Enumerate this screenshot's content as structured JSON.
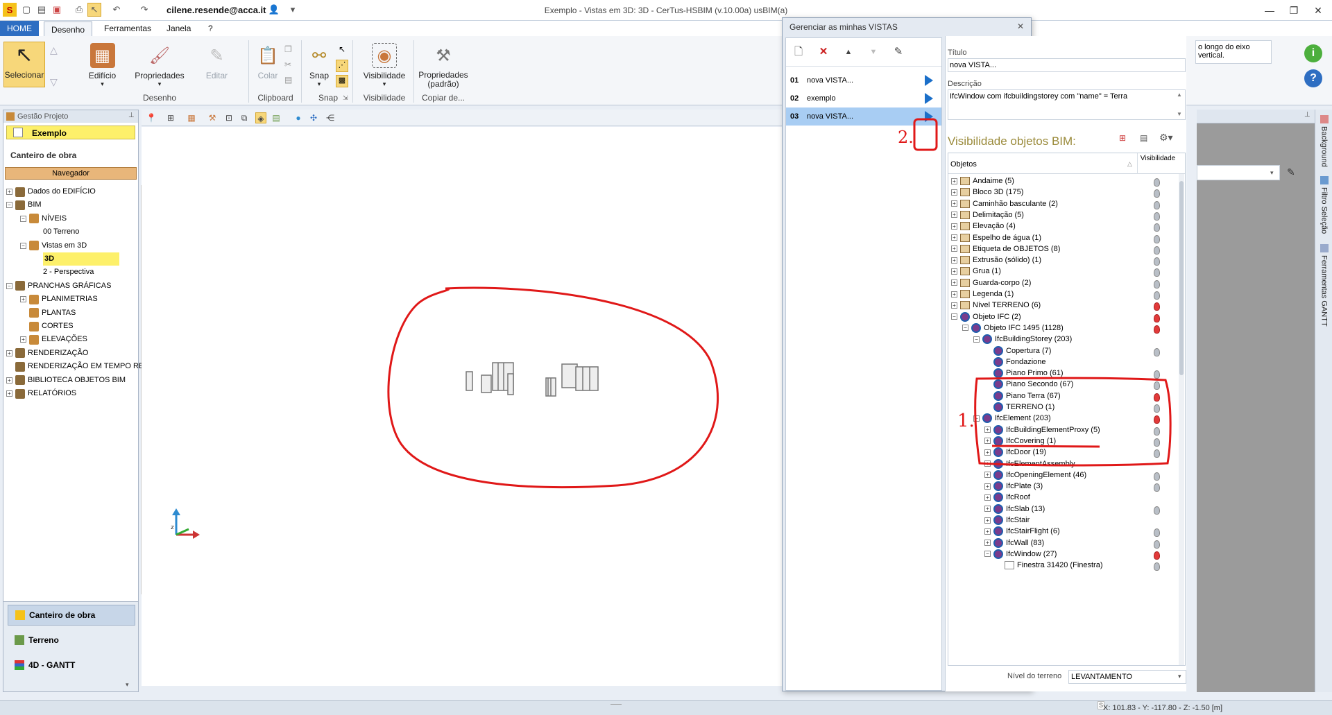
{
  "titlebar": {
    "user": "cilene.resende@acca.it",
    "window_title": "Exemplo - Vistas em 3D: 3D - CerTus-HSBIM (v.10.00a) usBIM(a)",
    "minimize": "—",
    "maximize": "❐",
    "close": "✕"
  },
  "menu": {
    "home": "HOME",
    "desenho": "Desenho",
    "ferramentas": "Ferramentas",
    "janela": "Janela",
    "help": "?"
  },
  "ribbon": {
    "selecionar": "Selecionar",
    "edificio": "Edifício",
    "propriedades": "Propriedades",
    "editar": "Editar",
    "colar": "Colar",
    "snap": "Snap",
    "visibilidade": "Visibilidade",
    "propriedades_padrao": "Propriedades (padrão)",
    "group_desenho": "Desenho",
    "group_clipboard": "Clipboard",
    "group_snap": "Snap",
    "group_visibilidade": "Visibilidade",
    "group_copiar": "Copiar de..."
  },
  "left_panel": {
    "header": "Gestão Projeto",
    "project": "Exemplo",
    "section": "Canteiro de obra",
    "navigator": "Navegador",
    "tree": [
      {
        "label": "Dados do EDIFÍCIO",
        "level": 0,
        "expander": "+"
      },
      {
        "label": "BIM",
        "level": 0,
        "expander": "−"
      },
      {
        "label": "NÍVEIS",
        "level": 1,
        "expander": "−"
      },
      {
        "label": "00 Terreno",
        "level": 2,
        "expander": ""
      },
      {
        "label": "Vistas em 3D",
        "level": 1,
        "expander": "−"
      },
      {
        "label": "3D",
        "level": 2,
        "expander": "",
        "highlight": true
      },
      {
        "label": "2 - Perspectiva",
        "level": 2,
        "expander": ""
      },
      {
        "label": "PRANCHAS GRÁFICAS",
        "level": 0,
        "expander": "−"
      },
      {
        "label": "PLANIMETRIAS",
        "level": 1,
        "expander": "+"
      },
      {
        "label": "PLANTAS",
        "level": 1,
        "expander": ""
      },
      {
        "label": "CORTES",
        "level": 1,
        "expander": ""
      },
      {
        "label": "ELEVAÇÕES",
        "level": 1,
        "expander": "+"
      },
      {
        "label": "RENDERIZAÇÃO",
        "level": 0,
        "expander": "+"
      },
      {
        "label": "RENDERIZAÇÃO EM TEMPO RE...",
        "level": 0,
        "expander": ""
      },
      {
        "label": "BIBLIOTECA OBJETOS BIM",
        "level": 0,
        "expander": "+"
      },
      {
        "label": "RELATÓRIOS",
        "level": 0,
        "expander": "+"
      }
    ],
    "bottom_tabs": [
      "Canteiro de obra",
      "Terreno",
      "4D - GANTT"
    ]
  },
  "dialog": {
    "title": "Gerenciar as minhas VISTAS",
    "views": [
      {
        "num": "01",
        "label": "nova VISTA..."
      },
      {
        "num": "02",
        "label": "exemplo"
      },
      {
        "num": "03",
        "label": "nova VISTA..."
      }
    ],
    "titulo_label": "Título",
    "titulo_value": "nova VISTA...",
    "descricao_label": "Descrição",
    "descricao_value": "IfcWindow com ifcbuildingstorey com \"name\" = Terra",
    "bim_title": "Visibilidade objetos BIM:",
    "col_objetos": "Objetos",
    "col_visibilidade": "Visibilidade",
    "bim_rows": [
      {
        "label": "Andaime (5)",
        "level": 0,
        "exp": "+",
        "icon": "obj",
        "bulb": "grey"
      },
      {
        "label": "Bloco 3D (175)",
        "level": 0,
        "exp": "+",
        "icon": "obj",
        "bulb": "grey"
      },
      {
        "label": "Caminhão basculante (2)",
        "level": 0,
        "exp": "+",
        "icon": "obj",
        "bulb": "grey"
      },
      {
        "label": "Delimitação (5)",
        "level": 0,
        "exp": "+",
        "icon": "obj",
        "bulb": "grey"
      },
      {
        "label": "Elevação (4)",
        "level": 0,
        "exp": "+",
        "icon": "obj",
        "bulb": "grey"
      },
      {
        "label": "Espelho de água (1)",
        "level": 0,
        "exp": "+",
        "icon": "obj",
        "bulb": "grey"
      },
      {
        "label": "Etiqueta de OBJETOS (8)",
        "level": 0,
        "exp": "+",
        "icon": "obj",
        "bulb": "grey"
      },
      {
        "label": "Extrusão (sólido) (1)",
        "level": 0,
        "exp": "+",
        "icon": "obj",
        "bulb": "grey"
      },
      {
        "label": "Grua (1)",
        "level": 0,
        "exp": "+",
        "icon": "obj",
        "bulb": "grey"
      },
      {
        "label": "Guarda-corpo (2)",
        "level": 0,
        "exp": "+",
        "icon": "obj",
        "bulb": "grey"
      },
      {
        "label": "Legenda (1)",
        "level": 0,
        "exp": "+",
        "icon": "obj",
        "bulb": "grey"
      },
      {
        "label": "Nível TERRENO (6)",
        "level": 0,
        "exp": "+",
        "icon": "obj",
        "bulb": "red"
      },
      {
        "label": "Objeto IFC (2)",
        "level": 0,
        "exp": "−",
        "icon": "ifc",
        "bulb": "red"
      },
      {
        "label": "Objeto IFC 1495 (1128)",
        "level": 1,
        "exp": "−",
        "icon": "ifc",
        "bulb": "red"
      },
      {
        "label": "IfcBuildingStorey (203)",
        "level": 2,
        "exp": "−",
        "icon": "ifc",
        "bulb": "none"
      },
      {
        "label": "Copertura (7)",
        "level": 3,
        "exp": "",
        "icon": "ifc",
        "bulb": "grey"
      },
      {
        "label": "Fondazione",
        "level": 3,
        "exp": "",
        "icon": "ifc",
        "bulb": "none"
      },
      {
        "label": "Piano Primo (61)",
        "level": 3,
        "exp": "",
        "icon": "ifc",
        "bulb": "grey"
      },
      {
        "label": "Piano Secondo (67)",
        "level": 3,
        "exp": "",
        "icon": "ifc",
        "bulb": "grey"
      },
      {
        "label": "Piano Terra (67)",
        "level": 3,
        "exp": "",
        "icon": "ifc",
        "bulb": "red"
      },
      {
        "label": "TERRENO (1)",
        "level": 3,
        "exp": "",
        "icon": "ifc",
        "bulb": "grey"
      },
      {
        "label": "IfcElement (203)",
        "level": 2,
        "exp": "−",
        "icon": "ifc",
        "bulb": "red"
      },
      {
        "label": "IfcBuildingElementProxy (5)",
        "level": 3,
        "exp": "+",
        "icon": "ifc",
        "bulb": "grey"
      },
      {
        "label": "IfcCovering (1)",
        "level": 3,
        "exp": "+",
        "icon": "ifc",
        "bulb": "grey"
      },
      {
        "label": "IfcDoor (19)",
        "level": 3,
        "exp": "+",
        "icon": "ifc",
        "bulb": "grey"
      },
      {
        "label": "IfcElementAssembly",
        "level": 3,
        "exp": "+",
        "icon": "ifc",
        "bulb": "none"
      },
      {
        "label": "IfcOpeningElement (46)",
        "level": 3,
        "exp": "+",
        "icon": "ifc",
        "bulb": "grey"
      },
      {
        "label": "IfcPlate (3)",
        "level": 3,
        "exp": "+",
        "icon": "ifc",
        "bulb": "grey"
      },
      {
        "label": "IfcRoof",
        "level": 3,
        "exp": "+",
        "icon": "ifc",
        "bulb": "none"
      },
      {
        "label": "IfcSlab (13)",
        "level": 3,
        "exp": "+",
        "icon": "ifc",
        "bulb": "grey"
      },
      {
        "label": "IfcStair",
        "level": 3,
        "exp": "+",
        "icon": "ifc",
        "bulb": "none"
      },
      {
        "label": "IfcStairFlight (6)",
        "level": 3,
        "exp": "+",
        "icon": "ifc",
        "bulb": "grey"
      },
      {
        "label": "IfcWall (83)",
        "level": 3,
        "exp": "+",
        "icon": "ifc",
        "bulb": "grey"
      },
      {
        "label": "IfcWindow (27)",
        "level": 3,
        "exp": "−",
        "icon": "ifc",
        "bulb": "red"
      },
      {
        "label": "Finestra 31420 (Finestra)",
        "level": 4,
        "exp": "",
        "icon": "win",
        "bulb": "grey"
      }
    ],
    "nivel_label": "Nível do terreno",
    "nivel_value": "LEVANTAMENTO"
  },
  "right_area": {
    "tooltip_text": "o longo do eixo vertical.",
    "side_tabs": [
      "Background",
      "Filtro Seleção",
      "Ferramentas GANTT"
    ]
  },
  "annotations": {
    "mark1": "1.",
    "mark2": "2."
  },
  "status": {
    "coords": "X: 101.83 - Y: -117.80 - Z: -1.50 [m]"
  },
  "colors": {
    "accent": "#2e6ec2",
    "highlight": "#fdf06a",
    "annotation": "#e01818",
    "selected_row": "#a8cdf3"
  }
}
